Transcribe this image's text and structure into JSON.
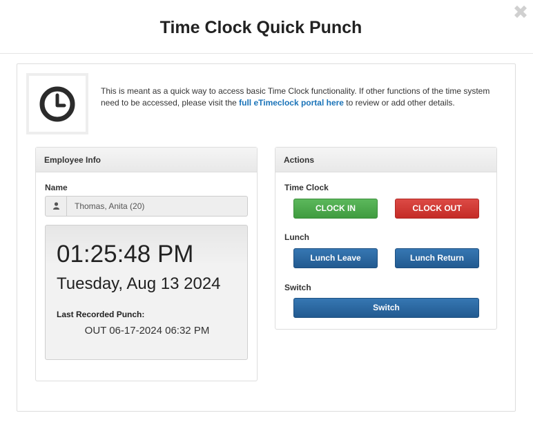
{
  "modal": {
    "title": "Time Clock Quick Punch"
  },
  "intro": {
    "text_before": "This is meant as a quick way to access basic Time Clock functionality. If other functions of the time system need to be accessed, please visit the ",
    "link_text": "full eTimeclock portal here",
    "text_after": " to review or add other details."
  },
  "employee": {
    "heading": "Employee Info",
    "name_label": "Name",
    "name_value": "Thomas, Anita (20)",
    "time": "01:25:48 PM",
    "date": "Tuesday, Aug 13 2024",
    "last_punch_label": "Last Recorded Punch:",
    "last_punch_value": "OUT 06-17-2024 06:32 PM"
  },
  "actions": {
    "heading": "Actions",
    "time_clock_label": "Time Clock",
    "clock_in": "CLOCK IN",
    "clock_out": "CLOCK OUT",
    "lunch_label": "Lunch",
    "lunch_leave": "Lunch Leave",
    "lunch_return": "Lunch Return",
    "switch_label": "Switch",
    "switch_button": "Switch"
  },
  "colors": {
    "green": "#4cae4c",
    "red": "#d43f3a",
    "blue": "#2a6aa5",
    "link": "#1a73b8"
  },
  "icons": [
    "clock-icon",
    "close-icon",
    "user-icon"
  ]
}
